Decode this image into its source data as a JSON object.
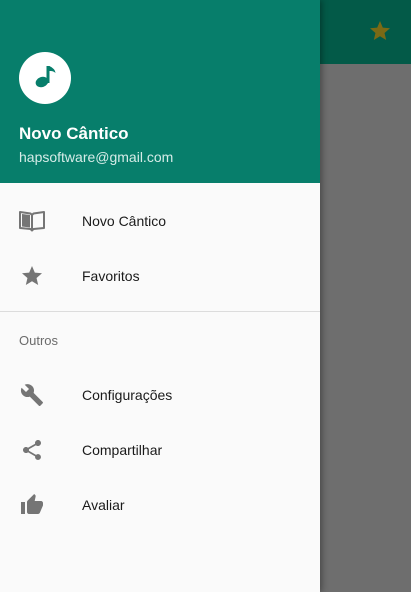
{
  "background": {
    "star_icon": "star-icon",
    "star_color": "#7a6a15"
  },
  "drawer": {
    "header": {
      "avatar_icon": "music-note-icon",
      "name": "Novo Cântico",
      "email": "hapsoftware@gmail.com",
      "color": "#077e6b"
    },
    "items": [
      {
        "label": "Novo Cântico",
        "icon": "book-icon"
      },
      {
        "label": "Favoritos",
        "icon": "star-icon"
      }
    ],
    "section_title": "Outros",
    "other_items": [
      {
        "label": "Configurações",
        "icon": "wrench-icon"
      },
      {
        "label": "Compartilhar",
        "icon": "share-icon"
      },
      {
        "label": "Avaliar",
        "icon": "thumbs-up-icon"
      }
    ]
  }
}
